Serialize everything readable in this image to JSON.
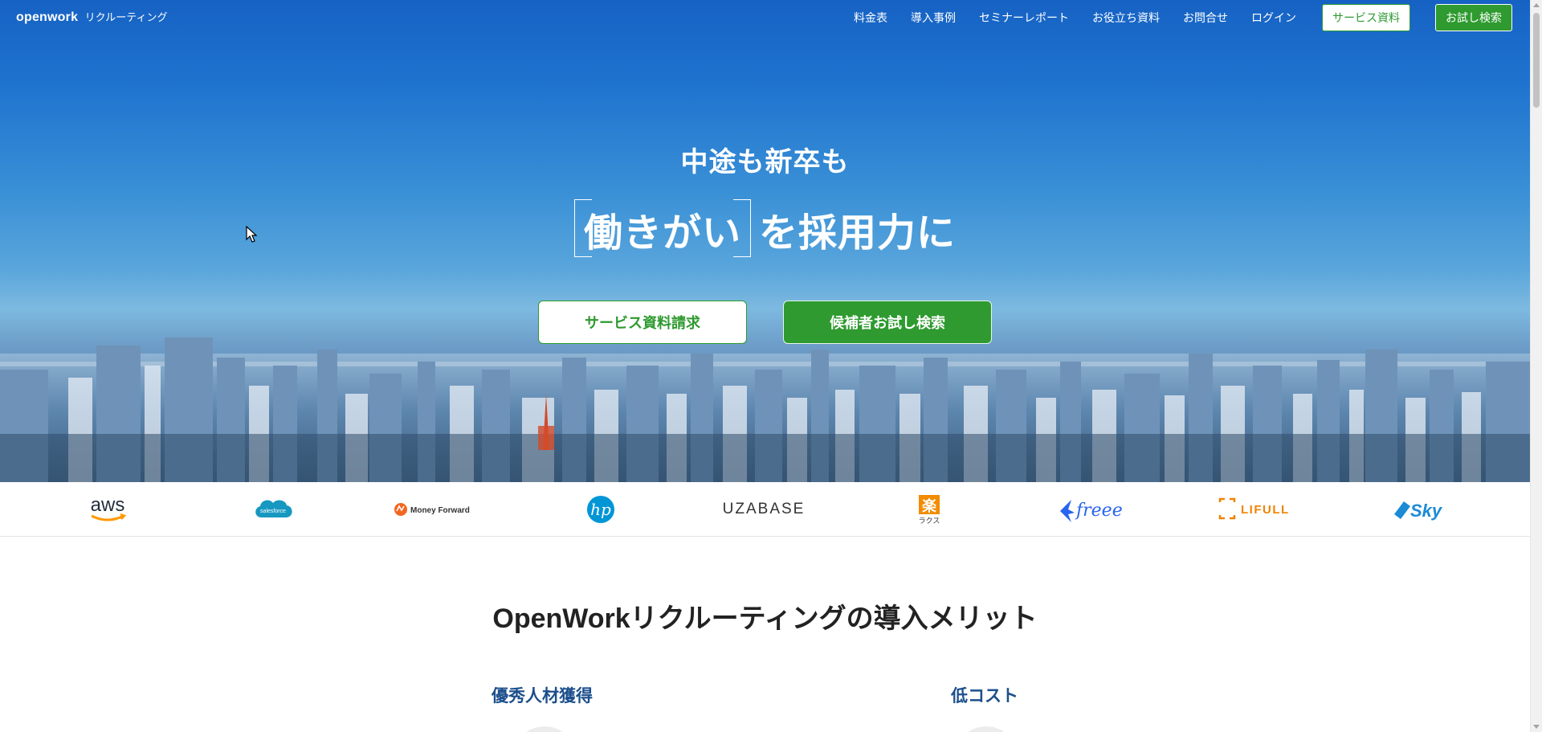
{
  "header": {
    "logo_main": "openwork",
    "logo_sub": "リクルーティング",
    "nav": [
      {
        "label": "料金表"
      },
      {
        "label": "導入事例"
      },
      {
        "label": "セミナーレポート"
      },
      {
        "label": "お役立ち資料"
      },
      {
        "label": "お問合せ"
      },
      {
        "label": "ログイン"
      }
    ],
    "btn_service_doc": "サービス資料",
    "btn_trial_search": "お試し検索"
  },
  "hero": {
    "subtitle": "中途も新卒も",
    "highlight": "働きがい",
    "title_rest": "を採用力に",
    "cta_primary": "サービス資料請求",
    "cta_secondary": "候補者お試し検索"
  },
  "client_logos": [
    {
      "name": "aws",
      "text": "aws"
    },
    {
      "name": "salesforce",
      "text": "salesforce"
    },
    {
      "name": "money-forward",
      "text": "Money Forward"
    },
    {
      "name": "hp",
      "text": "hp"
    },
    {
      "name": "uzabase",
      "text": "UZABASE"
    },
    {
      "name": "rakus",
      "text": "楽",
      "sub": "ラクス"
    },
    {
      "name": "freee",
      "text": "freee"
    },
    {
      "name": "lifull",
      "text": "LIFULL"
    },
    {
      "name": "sky",
      "text": "Sky"
    }
  ],
  "merits": {
    "title": "OpenWorkリクルーティングの導入メリット",
    "items": [
      {
        "label": "優秀人材獲得"
      },
      {
        "label": "低コスト"
      }
    ]
  },
  "colors": {
    "brand_green": "#2e9a2f",
    "merit_blue": "#1c4f8c",
    "sky_top": "#1662c4"
  }
}
